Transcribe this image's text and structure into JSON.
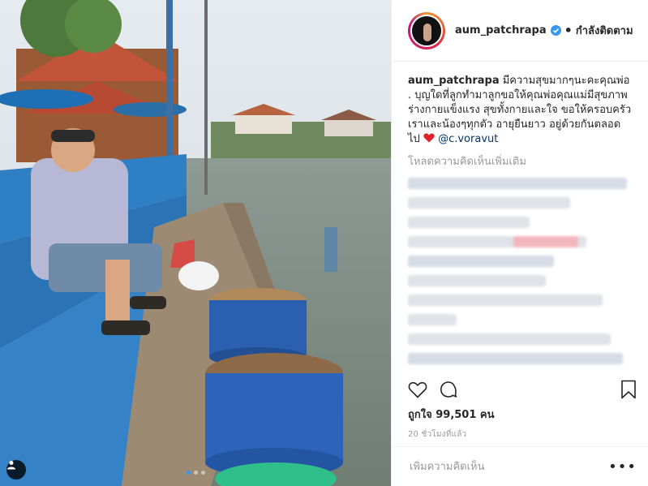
{
  "post": {
    "username": "aum_patchrapa",
    "separator": "•",
    "follow_status": "กำลังติดตาม"
  },
  "caption": {
    "username": "aum_patchrapa",
    "text": "มีความสุขมากๆนะคะคุณพ่อ . บุญใดที่ลูกทำมาลูกขอให้คุณพ่อคุณแม่มีสุขภาพร่างกายแข็งแรง สุขทั้งกายและใจ ขอให้ครอบครัวเราและน้องๆทุกตัว อายุยืนยาว อยู่ด้วยกันตลอดไป",
    "mention": "@c.voravut"
  },
  "comments": {
    "load_more": "โหลดความคิดเห็นเพิ่มเติม"
  },
  "stats": {
    "likes": "ถูกใจ 99,501 คน",
    "time": "20 ชั่วโมงที่แล้ว"
  },
  "comment_box": {
    "placeholder": "เพิ่มความคิดเห็น",
    "more_label": "•••"
  },
  "icons": {
    "verified": "verified-badge-icon",
    "heart": "heart-icon",
    "comment": "comment-icon",
    "bookmark": "bookmark-icon",
    "user_tag": "user-tag-icon"
  },
  "carousel": {
    "slides": 3,
    "current": 1
  },
  "colors": {
    "accent": "#3897f0",
    "heart": "#ed4956",
    "text": "#262626",
    "muted": "#999999"
  }
}
